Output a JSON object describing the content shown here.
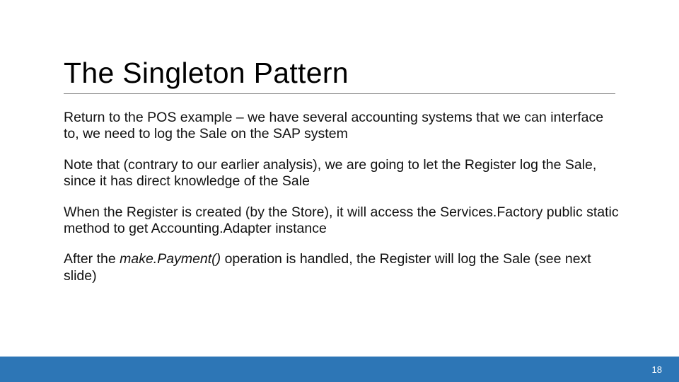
{
  "slide": {
    "title": "The Singleton Pattern",
    "paragraphs": [
      "Return to the POS example – we have several accounting systems that we can interface to, we need to log the Sale on the SAP system",
      "Note that (contrary to our earlier analysis), we are going to let the Register log the Sale, since it has direct knowledge of the Sale",
      "When the Register is created (by the Store), it will access the Services.Factory public static method to get Accounting.Adapter instance"
    ],
    "final_paragraph": {
      "prefix": "After the ",
      "operation": "make.Payment()",
      "suffix": " operation is handled, the Register will log the Sale (see next slide)"
    },
    "page_number": "18"
  }
}
